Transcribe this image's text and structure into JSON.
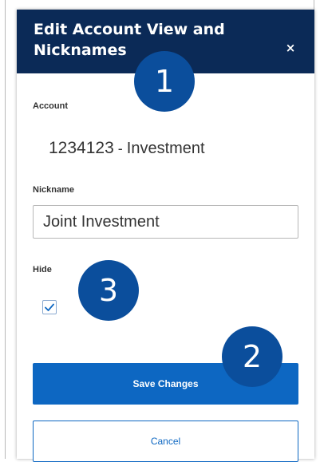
{
  "dialog": {
    "title": "Edit Account View and Nicknames",
    "close_label": "×"
  },
  "account": {
    "label": "Account",
    "number": "1234123",
    "separator": " - ",
    "type": "Investment"
  },
  "nickname": {
    "label": "Nickname",
    "value": "Joint Investment"
  },
  "hide": {
    "label": "Hide",
    "checked": true
  },
  "buttons": {
    "save_label": "Save Changes",
    "cancel_label": "Cancel"
  },
  "callouts": [
    "1",
    "2",
    "3"
  ],
  "colors": {
    "header_bg": "#0b2a57",
    "primary": "#0d67c2",
    "callout_bg": "#0b4e9c"
  }
}
